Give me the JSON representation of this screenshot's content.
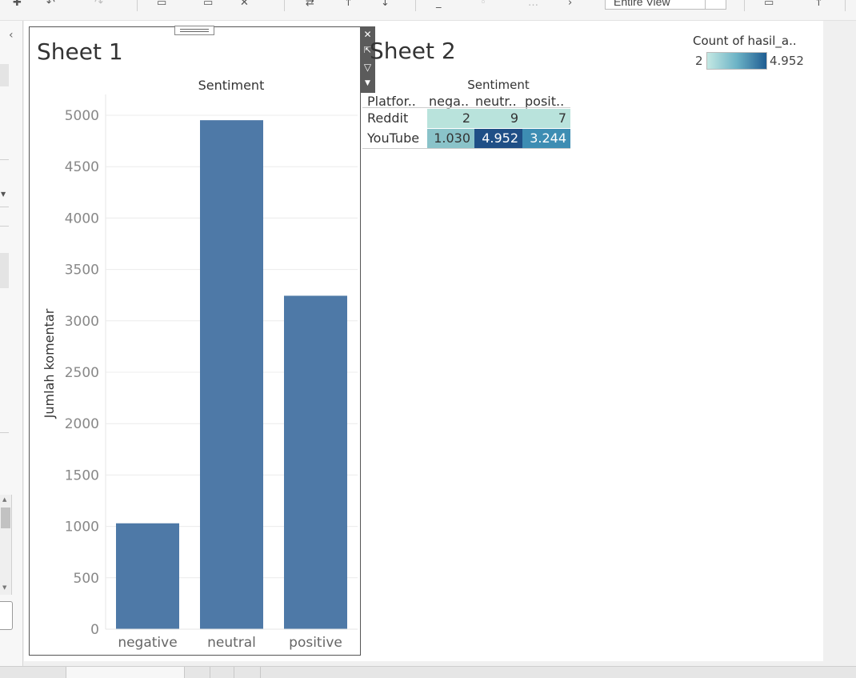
{
  "toolbar": {
    "fit_value": "Entire View"
  },
  "sheet1": {
    "title": "Sheet 1",
    "chart_data": {
      "type": "bar",
      "title": "Sentiment",
      "xlabel": "",
      "ylabel": "Jumlah komentar",
      "categories": [
        "negative",
        "neutral",
        "positive"
      ],
      "values": [
        1030,
        4952,
        3244
      ],
      "ylim": [
        0,
        5200
      ],
      "yticks": [
        0,
        500,
        1000,
        1500,
        2000,
        2500,
        3000,
        3500,
        4000,
        4500,
        5000
      ],
      "grid": true,
      "bar_color": "#4e79a7"
    }
  },
  "sheet2": {
    "title": "Sheet 2",
    "legend": {
      "title": "Count of hasil_a..",
      "min_label": "2",
      "max_label": "4.952"
    },
    "table": {
      "column_group_header": "Sentiment",
      "row_header": "Platfor..",
      "columns": [
        "nega..",
        "neutr..",
        "posit.."
      ],
      "rows": [
        {
          "label": "Reddit",
          "values": [
            "2",
            "9",
            "7"
          ]
        },
        {
          "label": "YouTube",
          "values": [
            "1.030",
            "4.952",
            "3.244"
          ]
        }
      ]
    },
    "colors": {
      "low": "#b9e3dc",
      "mid_low": "#8ac3c9",
      "mid_high": "#3d8db3",
      "high": "#1f4f86"
    }
  }
}
